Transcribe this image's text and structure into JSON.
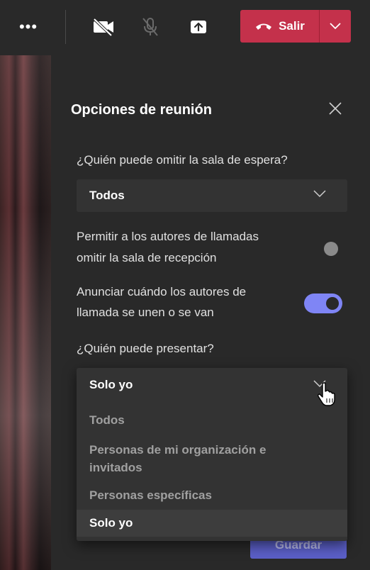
{
  "toolbar": {
    "more_icon": "ellipsis-icon",
    "camera_icon": "camera-off-icon",
    "mic_icon": "mic-off-icon",
    "share_icon": "share-tray-icon",
    "leave_label": "Salir",
    "leave_color": "#c4314b"
  },
  "panel": {
    "title": "Opciones de reunión",
    "lobby_question": "¿Quién puede omitir la sala de espera?",
    "lobby_value": "Todos",
    "callers_line1": "Permitir a los autores de llamadas",
    "callers_line2": "omitir la sala de recepción",
    "callers_toggle": "off",
    "announce_line1": "Anunciar cuándo los autores de",
    "announce_line2": "llamada se unen o se van",
    "announce_toggle": "on",
    "presenter_question": "¿Quién puede presentar?",
    "presenter_value": "Solo yo",
    "presenter_options": [
      "Todos",
      "Personas de mi organización e",
      "invitados",
      "Personas específicas",
      "Solo yo"
    ],
    "save_label": "Guardar",
    "accent": "#7f85f5"
  }
}
